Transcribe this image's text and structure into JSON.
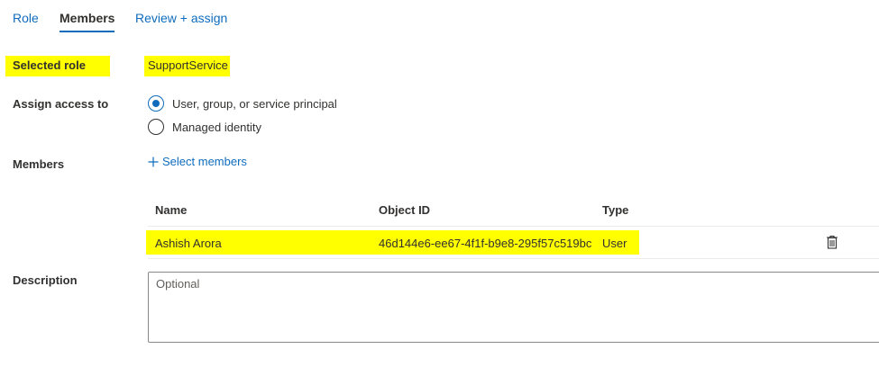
{
  "tabs": [
    {
      "label": "Role"
    },
    {
      "label": "Members"
    },
    {
      "label": "Review + assign"
    }
  ],
  "selected_role": {
    "label": "Selected role",
    "value": "SupportService"
  },
  "assign_access": {
    "label": "Assign access to",
    "options": [
      {
        "label": "User, group, or service principal",
        "checked": true
      },
      {
        "label": "Managed identity",
        "checked": false
      }
    ]
  },
  "members": {
    "label": "Members",
    "select_link": "Select members",
    "plus_icon": "plus-icon",
    "columns": [
      "Name",
      "Object ID",
      "Type"
    ],
    "rows": [
      {
        "name": "Ashish Arora",
        "object_id": "46d144e6-ee67-4f1f-b9e8-295f57c519bc",
        "type": "User"
      }
    ],
    "delete_icon": "trash-icon"
  },
  "description": {
    "label": "Description",
    "placeholder": "Optional"
  },
  "colors": {
    "accent": "#0f6cbd",
    "highlight": "#ffff00",
    "text": "#323130"
  }
}
